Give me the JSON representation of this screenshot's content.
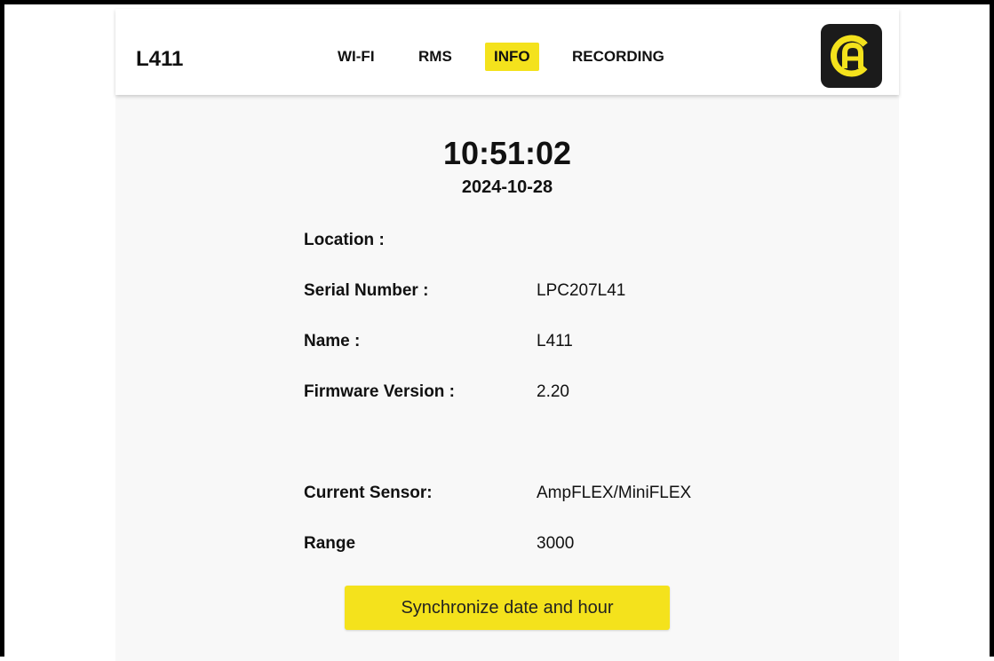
{
  "header": {
    "brand": "L411",
    "nav": [
      {
        "label": "WI-FI",
        "active": false
      },
      {
        "label": "RMS",
        "active": false
      },
      {
        "label": "INFO",
        "active": true
      },
      {
        "label": "RECORDING",
        "active": false
      }
    ],
    "logo_icon": "ca-logo-icon"
  },
  "main": {
    "time": "10:51:02",
    "date": "2024-10-28",
    "fields": [
      {
        "label": "Location :",
        "value": ""
      },
      {
        "label": "Serial Number :",
        "value": "LPC207L41"
      },
      {
        "label": "Name :",
        "value": "L411"
      },
      {
        "label": "Firmware Version :",
        "value": "2.20"
      },
      {
        "label": "Current Sensor:",
        "value": "AmpFLEX/MiniFLEX"
      },
      {
        "label": "Range",
        "value": "3000"
      }
    ],
    "sync_button": "Synchronize date and hour"
  },
  "colors": {
    "accent": "#f4e21c",
    "logo_bg": "#1b1b1b",
    "page_bg": "#f8f8f8"
  }
}
